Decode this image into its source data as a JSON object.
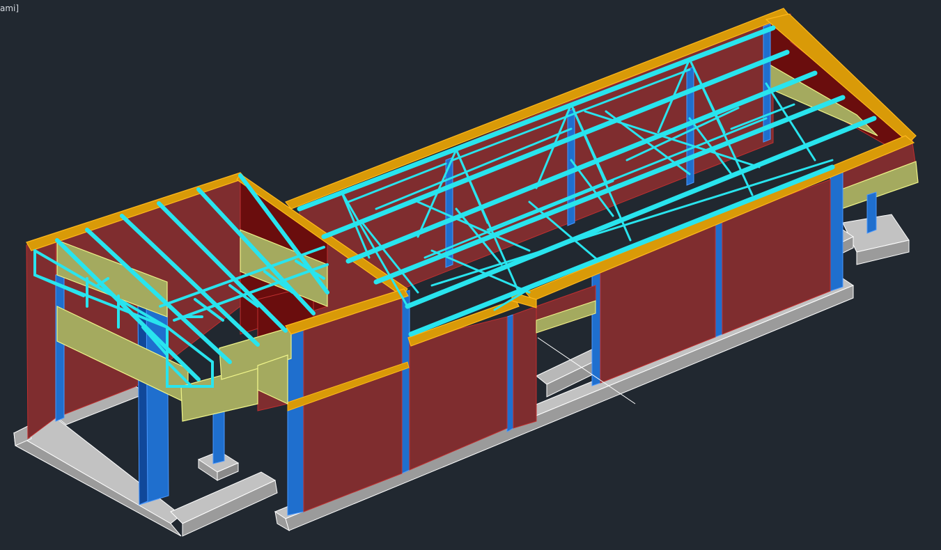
{
  "viewport": {
    "label": "ami]",
    "background": "#212830"
  },
  "colors": {
    "footing_top": "#c2c2c2",
    "footing_side": "#9b9b9b",
    "footing_edge": "#ffffff",
    "wall": "#7f2d2f",
    "wall_dark": "#6a0d0d",
    "wall_edge": "#c03030",
    "column": "#1f6fce",
    "column_dark": "#10489a",
    "beam_orange": "#d99a08",
    "beam_orange_edge": "#ffb81c",
    "beam_yellow": "#a4aa5f",
    "beam_yellow_edge": "#f0f58a",
    "truss_cyan": "#29e4ee",
    "crosshair": "#ffffff"
  },
  "icons": {
    "crosshair": "crosshair-cursor-icon"
  }
}
